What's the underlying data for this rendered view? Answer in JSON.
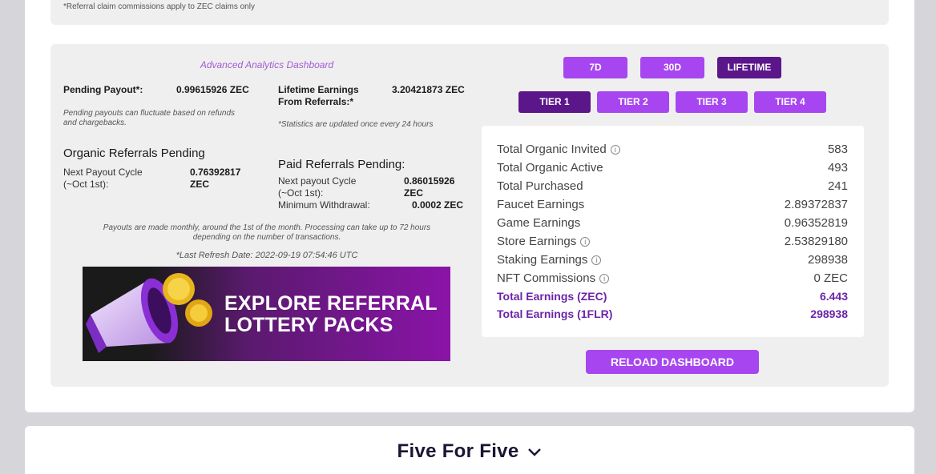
{
  "notice": "*Referral claim commissions apply to ZEC claims only",
  "dashboard": {
    "title": "Advanced Analytics Dashboard",
    "pending_payout_label": "Pending Payout*:",
    "pending_payout_value": "0.99615926 ZEC",
    "pending_note": "Pending payouts can fluctuate based on refunds and chargebacks.",
    "lifetime_label_1": "Lifetime Earnings",
    "lifetime_label_2": "From Referrals:*",
    "lifetime_value": "3.20421873 ZEC",
    "stats_note": "*Statistics are updated once every 24 hours",
    "organic_heading": "Organic Referrals Pending",
    "organic_cycle_label_1": "Next Payout Cycle",
    "organic_cycle_label_2": "(~Oct 1st):",
    "organic_cycle_value_1": "0.76392817",
    "organic_cycle_value_2": "ZEC",
    "paid_heading": "Paid Referrals Pending:",
    "paid_cycle_label_1": "Next payout Cycle",
    "paid_cycle_label_2": "(~Oct 1st):",
    "paid_cycle_value_1": "0.86015926",
    "paid_cycle_value_2": "ZEC",
    "min_withdrawal_label": "Minimum Withdrawal:",
    "min_withdrawal_value": "0.0002 ZEC",
    "payout_note_1": "Payouts are made monthly, around the 1st of the month. Processing can take up to 72 hours",
    "payout_note_2": "depending on the number of transactions.",
    "last_refresh": "*Last Refresh Date: 2022-09-19 07:54:46 UTC",
    "banner_line_1": "EXPLORE REFERRAL",
    "banner_line_2": "LOTTERY PACKS"
  },
  "period_buttons": [
    "7D",
    "30D",
    "LIFETIME"
  ],
  "tier_buttons": [
    "TIER 1",
    "TIER 2",
    "TIER 3",
    "TIER 4"
  ],
  "stats": [
    {
      "label": "Total Organic Invited",
      "value": "583",
      "info": true
    },
    {
      "label": "Total Organic Active",
      "value": "493",
      "info": false
    },
    {
      "label": "Total Purchased",
      "value": "241",
      "info": false
    },
    {
      "label": "Faucet Earnings",
      "value": "2.89372837",
      "info": false
    },
    {
      "label": "Game Earnings",
      "value": "0.96352819",
      "info": false
    },
    {
      "label": "Store Earnings",
      "value": "2.53829180",
      "info": true
    },
    {
      "label": "Staking Earnings",
      "value": "298938",
      "info": true
    },
    {
      "label": "NFT Commissions",
      "value": "0 ZEC",
      "info": true
    },
    {
      "label": "Total Earnings (ZEC)",
      "value": "6.443",
      "info": false
    },
    {
      "label": "Total Earnings (1FLR)",
      "value": "298938",
      "info": false
    }
  ],
  "reload_label": "RELOAD DASHBOARD",
  "section_title": "Five For Five",
  "colors": {
    "accent": "#a746f0",
    "accent_dark": "#5b168a",
    "total_text": "#6b24a8"
  },
  "icons": {
    "info": "info-circle-icon",
    "chevron": "chevron-down-icon"
  }
}
